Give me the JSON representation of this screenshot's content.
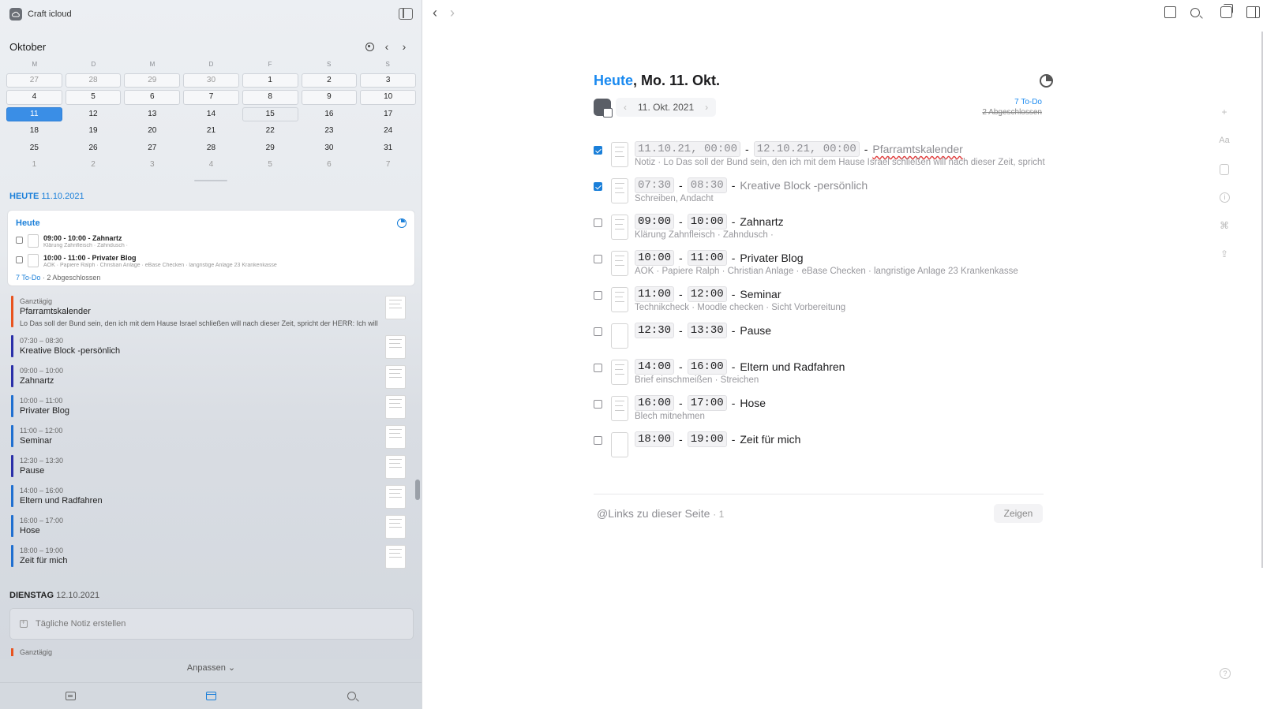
{
  "sidebar": {
    "app_name": "Craft icloud",
    "calendar": {
      "month": "Oktober",
      "weekdays": [
        "M",
        "D",
        "M",
        "D",
        "F",
        "S",
        "S"
      ],
      "weeks": [
        [
          "27",
          "28",
          "29",
          "30",
          "1",
          "2",
          "3"
        ],
        [
          "4",
          "5",
          "6",
          "7",
          "8",
          "9",
          "10"
        ],
        [
          "11",
          "12",
          "13",
          "14",
          "15",
          "16",
          "17"
        ],
        [
          "18",
          "19",
          "20",
          "21",
          "22",
          "23",
          "24"
        ],
        [
          "25",
          "26",
          "27",
          "28",
          "29",
          "30",
          "31"
        ],
        [
          "1",
          "2",
          "3",
          "4",
          "5",
          "6",
          "7"
        ]
      ],
      "selected_day": "11"
    },
    "today_heading": {
      "label": "HEUTE",
      "date": "11.10.2021"
    },
    "today_card": {
      "title": "Heute",
      "rows": [
        {
          "title": "09:00 - 10:00 - Zahnartz",
          "sub": "Klärung Zahnfleisch · Zahndusch ·"
        },
        {
          "title": "10:00 - 11:00 - Privater Blog",
          "sub": "AOK · Papiere Ralph · Christian Anlage · eBase Checken · langristige Anlage 23 Krankenkasse"
        }
      ],
      "todo_count": "7 To-Do",
      "done_count": "· 2 Abgeschlossen"
    },
    "events": [
      {
        "time": "Ganztägig",
        "title": "Pfarramtskalender",
        "sub": "Lo  Das soll der Bund sein, den ich mit dem Hause Israel schließen will nach dieser Zeit, spricht der HERR: Ich will mein Gesetz",
        "color": "#e8531f"
      },
      {
        "time": "07:30 – 08:30",
        "title": "Kreative Block -persönlich",
        "color": "#2a2fa8"
      },
      {
        "time": "09:00 – 10:00",
        "title": "Zahnartz",
        "color": "#2a2fa8"
      },
      {
        "time": "10:00 – 11:00",
        "title": "Privater Blog",
        "color": "#1f6fd0"
      },
      {
        "time": "11:00 – 12:00",
        "title": "Seminar",
        "color": "#1f6fd0"
      },
      {
        "time": "12:30 – 13:30",
        "title": "Pause",
        "color": "#2a2fa8"
      },
      {
        "time": "14:00 – 16:00",
        "title": "Eltern und Radfahren",
        "color": "#1f6fd0"
      },
      {
        "time": "16:00 – 17:00",
        "title": "Hose",
        "color": "#1f6fd0"
      },
      {
        "time": "18:00 – 19:00",
        "title": "Zeit für mich",
        "color": "#1f6fd0"
      }
    ],
    "tomorrow_heading": {
      "label": "DIENSTAG",
      "date": "12.10.2021"
    },
    "daily_note_label": "Tägliche Notiz erstellen",
    "next_allday": "Ganztägig",
    "customize_label": "Anpassen ⌄"
  },
  "main": {
    "title_highlight": "Heute",
    "title_rest": ", Mo. 11. Okt.",
    "date_pill": "11. Okt. 2021",
    "todo_summary": "7 To-Do",
    "done_summary": "2 Abgeschlossen",
    "items": [
      {
        "start": "11.10.21, 00:00",
        "end": "12.10.21, 00:00",
        "title": "Pfarramtskalender",
        "sub": "Notiz  · Lo  Das soll der Bund sein, den ich mit dem Hause Israel schließen will nach dieser Zeit, spricht der HERR",
        "checked": true
      },
      {
        "start": "07:30",
        "end": "08:30",
        "title": "Kreative Block -persönlich",
        "sub": "Schreiben, Andacht",
        "checked": true
      },
      {
        "start": "09:00",
        "end": "10:00",
        "title": "Zahnartz",
        "sub": "Klärung Zahnfleisch · Zahndusch ·",
        "checked": false
      },
      {
        "start": "10:00",
        "end": "11:00",
        "title": "Privater Blog",
        "sub": "AOK · Papiere Ralph · Christian Anlage · eBase Checken  · langristige Anlage 23 Krankenkasse",
        "checked": false
      },
      {
        "start": "11:00",
        "end": "12:00",
        "title": "Seminar",
        "sub": "Technikcheck · Moodle checken · Sicht Vorbereitung",
        "checked": false
      },
      {
        "start": "12:30",
        "end": "13:30",
        "title": "Pause",
        "sub": "",
        "checked": false
      },
      {
        "start": "14:00",
        "end": "16:00",
        "title": "Eltern und Radfahren",
        "sub": "Brief einschmeißen · Streichen",
        "checked": false
      },
      {
        "start": "16:00",
        "end": "17:00",
        "title": "Hose",
        "sub": "Blech mitnehmen",
        "checked": false
      },
      {
        "start": "18:00",
        "end": "19:00",
        "title": "Zeit für mich",
        "sub": "",
        "checked": false
      }
    ],
    "links_label": "@Links zu dieser Seite",
    "links_count": "· 1",
    "show_label": "Zeigen"
  },
  "icons": {
    "back": "chevron-left-icon",
    "forward": "chevron-right-icon",
    "plus": "+",
    "text_style": "Aa",
    "info": "i",
    "command": "⌘",
    "share": "⇪",
    "help": "?"
  }
}
